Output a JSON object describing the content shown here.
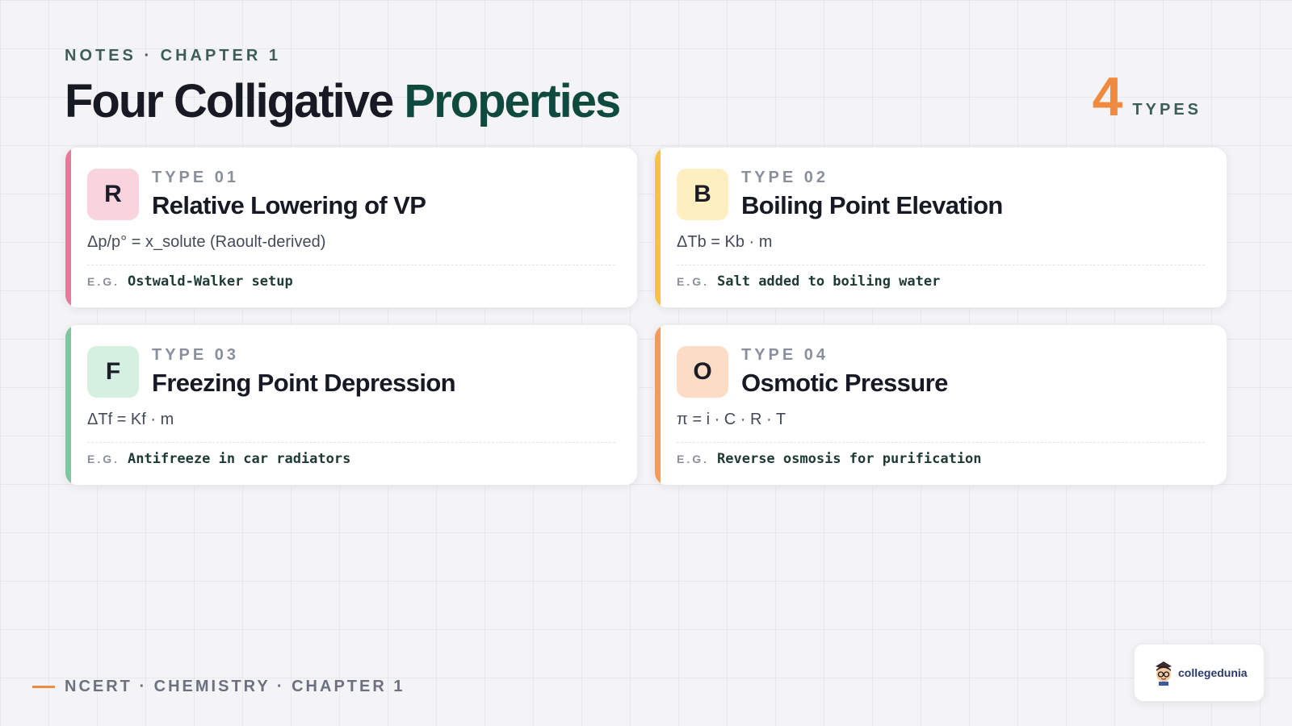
{
  "header": {
    "eyebrow": "NOTES · CHAPTER 1",
    "title_main": "Four Colligative",
    "title_accent": "Properties",
    "count": "4",
    "count_label": "TYPES"
  },
  "colors": {
    "accent_orange": "#f08a3e",
    "accent_green": "#0f4a3e"
  },
  "cards": [
    {
      "letter": "R",
      "type_label": "TYPE 01",
      "title": "Relative Lowering of VP",
      "formula": "Δp/p° = x_solute (Raoult-derived)",
      "eg_label": "E.G.",
      "example": "Ostwald-Walker setup",
      "bar_color": "#e8799a",
      "badge_color": "#f9d3de"
    },
    {
      "letter": "B",
      "type_label": "TYPE 02",
      "title": "Boiling Point Elevation",
      "formula": "ΔTb = Kb · m",
      "eg_label": "E.G.",
      "example": "Salt added to boiling water",
      "bar_color": "#f5c542",
      "badge_color": "#fdefbf"
    },
    {
      "letter": "F",
      "type_label": "TYPE 03",
      "title": "Freezing Point Depression",
      "formula": "ΔTf = Kf · m",
      "eg_label": "E.G.",
      "example": "Antifreeze in car radiators",
      "bar_color": "#7cc6a0",
      "badge_color": "#d5efe1"
    },
    {
      "letter": "O",
      "type_label": "TYPE 04",
      "title": "Osmotic Pressure",
      "formula": "π = i · C · R · T",
      "eg_label": "E.G.",
      "example": "Reverse osmosis for purification",
      "bar_color": "#f59a5a",
      "badge_color": "#fddcc6"
    }
  ],
  "footer": {
    "text": "NCERT · CHEMISTRY · CHAPTER 1"
  },
  "logo": {
    "text": "collegedunia",
    "icon": "mascot-icon"
  }
}
